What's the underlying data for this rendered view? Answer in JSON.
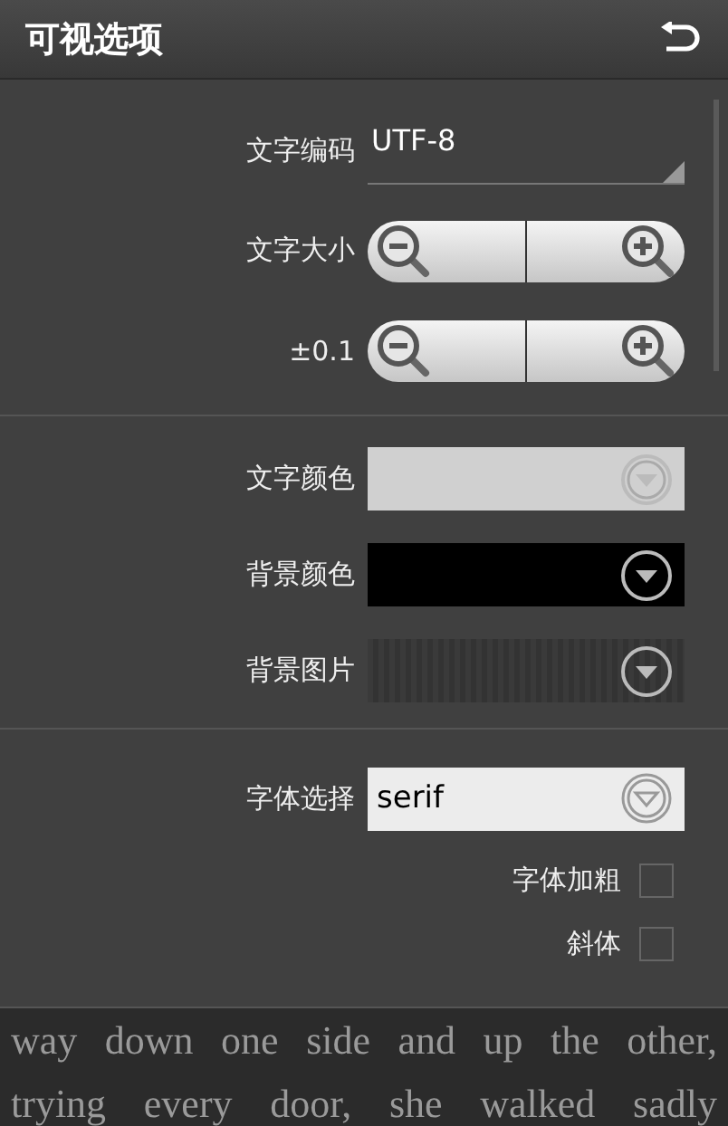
{
  "title_bar": {
    "title": "可视选项"
  },
  "sections": [
    {
      "rows": [
        {
          "kind": "dropdown",
          "label": "文字编码",
          "value": "UTF-8"
        },
        {
          "kind": "stepper",
          "label": "文字大小"
        },
        {
          "kind": "stepper",
          "label": "±0.1"
        }
      ]
    },
    {
      "rows": [
        {
          "kind": "color",
          "label": "文字颜色",
          "color": "#d0d0d0"
        },
        {
          "kind": "color",
          "label": "背景颜色",
          "color": "#000000"
        },
        {
          "kind": "image",
          "label": "背景图片"
        }
      ]
    },
    {
      "rows": [
        {
          "kind": "select",
          "label": "字体选择",
          "value": "serif"
        },
        {
          "kind": "checkbox",
          "label": "字体加粗",
          "checked": false
        },
        {
          "kind": "checkbox",
          "label": "斜体",
          "checked": false
        }
      ]
    }
  ],
  "preview": {
    "text": "way down one side and up the other, trying every door, she walked sadly"
  }
}
